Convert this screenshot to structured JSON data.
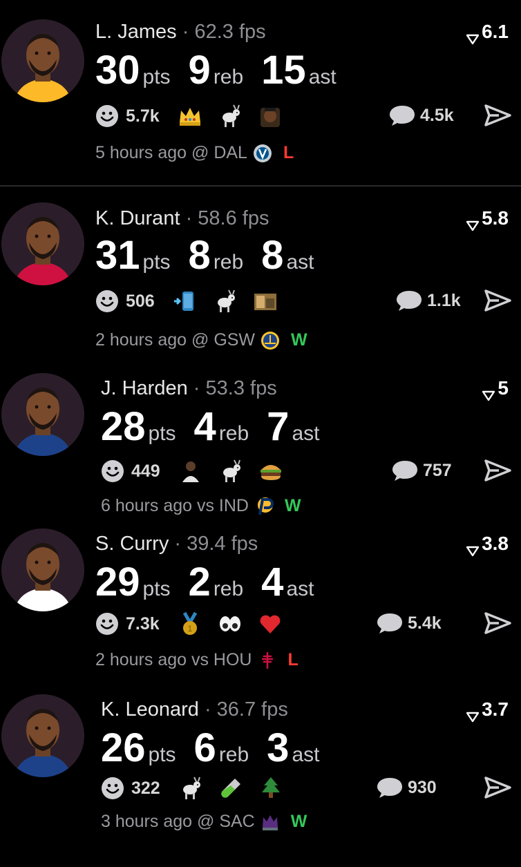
{
  "colors": {
    "background": "#000000",
    "muted": "#8e8e93",
    "win": "#34c759",
    "loss": "#ff3b30"
  },
  "units": {
    "pts": "pts",
    "reb": "reb",
    "ast": "ast"
  },
  "players": [
    {
      "name": "L. James",
      "fps": "· 62.3 fps",
      "score": "6.1",
      "pts": "30",
      "reb": "9",
      "ast": "15",
      "reactions": "5.7k",
      "emojis": [
        "crown-icon",
        "goat-icon",
        "face-icon"
      ],
      "comments": "4.5k",
      "time": "5 hours ago @ DAL",
      "opponent_logo": "mavericks-logo",
      "result": "L",
      "jersey": "#fdb927"
    },
    {
      "name": "K. Durant",
      "fps": "· 58.6 fps",
      "score": "5.8",
      "pts": "31",
      "reb": "8",
      "ast": "8",
      "reactions": "506",
      "emojis": [
        "phone-icon",
        "goat-icon",
        "photo-icon"
      ],
      "comments": "1.1k",
      "time": "2 hours ago @ GSW",
      "opponent_logo": "warriors-logo",
      "result": "W",
      "jersey": "#ce1141"
    },
    {
      "name": "J. Harden",
      "fps": "· 53.3 fps",
      "score": "5",
      "pts": "28",
      "reb": "4",
      "ast": "7",
      "reactions": "449",
      "emojis": [
        "person-icon",
        "goat-icon",
        "burger-icon"
      ],
      "comments": "757",
      "time": "6 hours ago vs IND",
      "opponent_logo": "pacers-logo",
      "result": "W",
      "jersey": "#1d428a"
    },
    {
      "name": "S. Curry",
      "fps": "· 39.4 fps",
      "score": "3.8",
      "pts": "29",
      "reb": "2",
      "ast": "4",
      "reactions": "7.3k",
      "emojis": [
        "medal-icon",
        "eyes-icon",
        "heart-icon"
      ],
      "comments": "5.4k",
      "time": "2 hours ago vs HOU",
      "opponent_logo": "rockets-logo",
      "result": "L",
      "jersey": "#ffffff"
    },
    {
      "name": "K. Leonard",
      "fps": "· 36.7 fps",
      "score": "3.7",
      "pts": "26",
      "reb": "6",
      "ast": "3",
      "reactions": "322",
      "emojis": [
        "goat-icon",
        "test-tube-icon",
        "tree-icon"
      ],
      "comments": "930",
      "time": "3 hours ago @ SAC",
      "opponent_logo": "kings-logo",
      "result": "W",
      "jersey": "#1d428a"
    }
  ]
}
